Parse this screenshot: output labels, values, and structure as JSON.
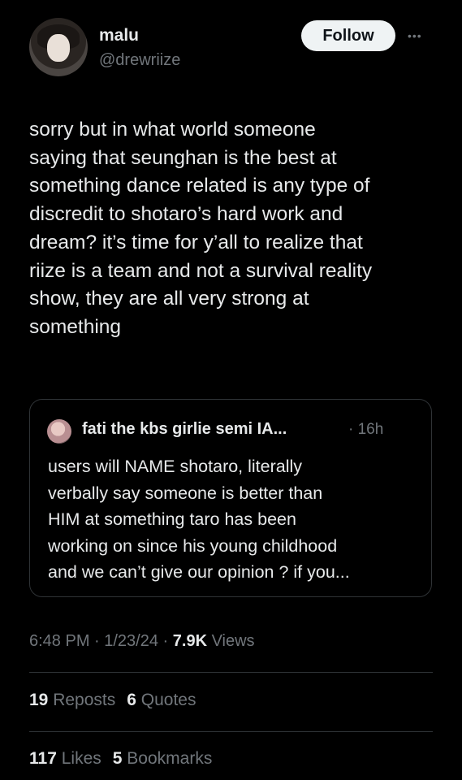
{
  "author": {
    "name": "malu",
    "handle": "@drewriize"
  },
  "follow_label": "Follow",
  "more_label": "•••",
  "tweet_text": "sorry but in what world someone\nsaying that seunghan is the best at\nsomething dance related is any type of\ndiscredit to shotaro’s hard work and\ndream? it’s time for y’all to realize that\nriize is a team and not a survival reality\nshow, they are all very strong at\nsomething",
  "quoted": {
    "name": "fati the kbs girlie semi IA...",
    "time": "· 16h",
    "text": "users will NAME shotaro, literally\nverbally say someone is better than\nHIM at something taro has been\nworking on since his young childhood\nand we can’t give our opinion ? if you..."
  },
  "meta": {
    "time_date": "6:48 PM · 1/23/24 · ",
    "views_count": "7.9K",
    "views_label": " Views"
  },
  "stats": {
    "reposts_count": "19",
    "reposts_label": "Reposts",
    "quotes_count": "6",
    "quotes_label": "Quotes",
    "likes_count": "117",
    "likes_label": "Likes",
    "bookmarks_count": "5",
    "bookmarks_label": "Bookmarks"
  }
}
